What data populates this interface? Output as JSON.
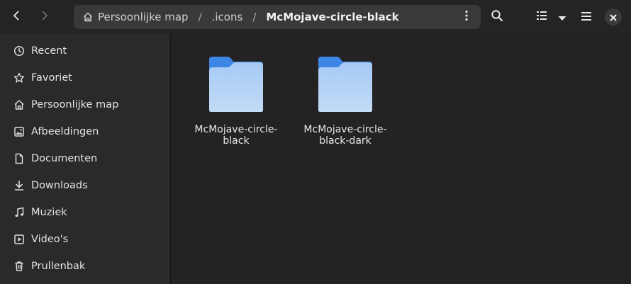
{
  "header": {
    "back_icon": "chevron-left-icon",
    "forward_icon": "chevron-right-icon",
    "path": [
      {
        "label": "Persoonlijke map",
        "icon": "home-icon"
      },
      {
        "label": ".icons"
      },
      {
        "label": "McMojave-circle-black",
        "current": true
      }
    ],
    "separator": "/",
    "path_menu_icon": "kebab-menu-icon",
    "search_icon": "search-icon",
    "view_icon": "list-view-icon",
    "view_dropdown_icon": "triangle-down-icon",
    "menu_icon": "hamburger-menu-icon",
    "close_icon": "close-icon"
  },
  "sidebar": {
    "items": [
      {
        "label": "Recent",
        "icon": "clock-icon"
      },
      {
        "label": "Favoriet",
        "icon": "star-icon"
      },
      {
        "label": "Persoonlijke map",
        "icon": "home-icon"
      },
      {
        "label": "Afbeeldingen",
        "icon": "image-icon"
      },
      {
        "label": "Documenten",
        "icon": "document-icon"
      },
      {
        "label": "Downloads",
        "icon": "download-icon"
      },
      {
        "label": "Muziek",
        "icon": "music-icon"
      },
      {
        "label": "Video's",
        "icon": "video-icon"
      },
      {
        "label": "Prullenbak",
        "icon": "trash-icon"
      }
    ]
  },
  "files": [
    {
      "name": "McMojave-circle-black",
      "type": "folder"
    },
    {
      "name": "McMojave-circle-black-dark",
      "type": "folder"
    }
  ],
  "colors": {
    "folder_back": "#3d86e6",
    "folder_front_top": "#a6c9f5",
    "folder_front_bottom": "#c2dcf6"
  }
}
